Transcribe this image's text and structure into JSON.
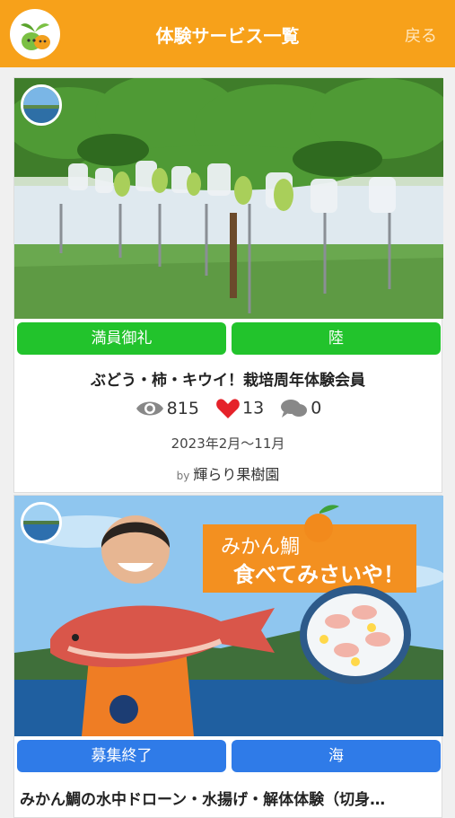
{
  "header": {
    "title": "体験サービス一覧",
    "back_label": "戻る"
  },
  "cards": [
    {
      "status_label": "満員御礼",
      "category_label": "陸",
      "title": "ぶどう・柿・キウイ！栽培周年体験会員",
      "views": "815",
      "likes": "13",
      "comments": "0",
      "date": "2023年2月～11月",
      "by_label": "by",
      "owner": "輝らり果樹園"
    },
    {
      "status_label": "募集終了",
      "category_label": "海",
      "title": "みかん鯛の水中ドローン・水揚げ・解体体験（切身…",
      "banner_line1": "みかん鯛",
      "banner_line2": "食べてみさいや！"
    }
  ],
  "colors": {
    "header": "#f7a11a",
    "green_button": "#22c32c",
    "blue_button": "#2f7be8"
  }
}
